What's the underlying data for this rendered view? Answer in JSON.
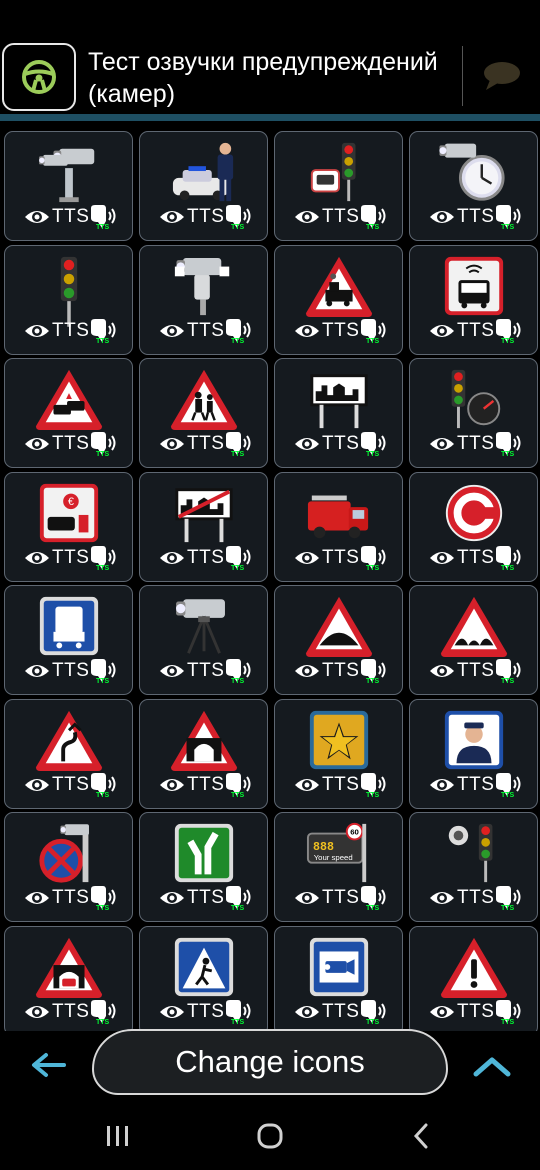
{
  "header": {
    "title": "Тест озвучки предупреждений (камер)"
  },
  "grid": {
    "tts_label": "TTS",
    "sound_sub": "TTS",
    "items": [
      {
        "icon": "speed-camera-pole-icon"
      },
      {
        "icon": "police-officer-car-icon"
      },
      {
        "icon": "red-light-camera-icon"
      },
      {
        "icon": "average-speed-camera-icon"
      },
      {
        "icon": "traffic-light-icon"
      },
      {
        "icon": "mobile-camera-icon"
      },
      {
        "icon": "railway-crossing-icon"
      },
      {
        "icon": "bus-lane-icon"
      },
      {
        "icon": "accident-warning-icon"
      },
      {
        "icon": "school-children-icon"
      },
      {
        "icon": "town-entry-sign-icon"
      },
      {
        "icon": "traffic-light-speed-icon"
      },
      {
        "icon": "toll-zone-icon"
      },
      {
        "icon": "town-exit-sign-icon"
      },
      {
        "icon": "fire-truck-icon"
      },
      {
        "icon": "congestion-charge-icon"
      },
      {
        "icon": "truck-sign-icon"
      },
      {
        "icon": "tripod-camera-icon"
      },
      {
        "icon": "speed-bump-icon"
      },
      {
        "icon": "rough-road-icon"
      },
      {
        "icon": "dangerous-curve-icon"
      },
      {
        "icon": "tunnel-icon"
      },
      {
        "icon": "favorite-star-icon"
      },
      {
        "icon": "police-post-icon"
      },
      {
        "icon": "no-stopping-camera-icon"
      },
      {
        "icon": "highway-exit-icon"
      },
      {
        "icon": "your-speed-display-icon"
      },
      {
        "icon": "traffic-light-sensor-icon"
      },
      {
        "icon": "tunnel-car-icon"
      },
      {
        "icon": "pedestrian-crossing-icon"
      },
      {
        "icon": "cctv-sign-icon"
      },
      {
        "icon": "general-danger-icon"
      }
    ],
    "your_speed_digits": "888",
    "your_speed_limit": "60",
    "your_speed_text": "Your speed"
  },
  "bottom": {
    "change_icons": "Change icons"
  },
  "colors": {
    "accent": "#1e4f63",
    "cell_bg": "#151a1f",
    "cell_border": "#5e6772",
    "nav_arrow": "#4fb6d8",
    "sound_tts": "#00ff33"
  }
}
